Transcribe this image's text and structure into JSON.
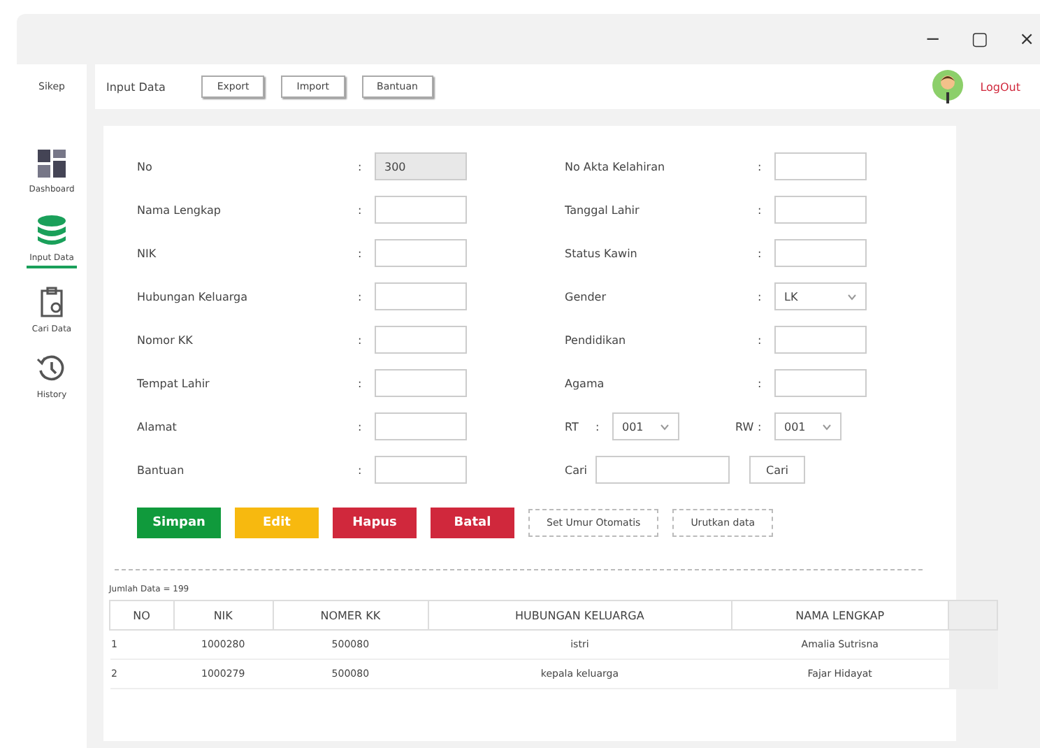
{
  "window": {
    "controls": [
      "−",
      "▢",
      "×"
    ]
  },
  "sidebar": {
    "logo": "Sikep",
    "items": [
      {
        "label": "Dashboard",
        "selected": false
      },
      {
        "label": "Input Data",
        "selected": true
      },
      {
        "label": "Cari Data",
        "selected": false
      },
      {
        "label": "History",
        "selected": false
      }
    ]
  },
  "header": {
    "title": "Input Data",
    "buttons": [
      "Export",
      "Import",
      "Bantuan"
    ],
    "logout": "LogOut"
  },
  "form": {
    "left": [
      {
        "label": "No",
        "colon": ":",
        "value": "300",
        "disabled": true
      },
      {
        "label": "Nama Lengkap",
        "colon": ":",
        "disabled": false
      },
      {
        "label": "NIK",
        "colon": ":",
        "disabled": false
      },
      {
        "label": "Hubungan Keluarga",
        "colon": ":",
        "disabled": false
      },
      {
        "label": "Nomor KK",
        "colon": ":",
        "disabled": false
      },
      {
        "label": "Tempat Lahir",
        "colon": ":",
        "disabled": false
      },
      {
        "label": "Alamat",
        "colon": ":",
        "disabled": false
      },
      {
        "label": "Bantuan",
        "colon": ":",
        "disabled": false
      }
    ],
    "right": [
      {
        "label": "No Akta Kelahiran",
        "colon": ":",
        "kind": "text"
      },
      {
        "label": "Tanggal Lahir",
        "colon": ":",
        "kind": "text"
      },
      {
        "label": "Status Kawin",
        "colon": ":",
        "kind": "text"
      },
      {
        "label": "Gender",
        "colon": ":",
        "kind": "select",
        "value": "LK"
      },
      {
        "label": "Pendidikan",
        "colon": ":",
        "kind": "text"
      },
      {
        "label": "Agama",
        "colon": ":",
        "kind": "text"
      }
    ],
    "rt": {
      "label": "RT",
      "colon": ":",
      "value": "001"
    },
    "rw": {
      "label": "RW",
      "colon": ":",
      "value": "001"
    },
    "search": {
      "label": "Cari",
      "button": "Cari"
    }
  },
  "actions": [
    {
      "label": "Simpan",
      "color": "#109a3c"
    },
    {
      "label": "Edit",
      "color": "#f7b90f"
    },
    {
      "label": "Hapus",
      "color": "#d0283c"
    },
    {
      "label": "Batal",
      "color": "#d0283c"
    }
  ],
  "extra_buttons": [
    "Set Umur Otomatis",
    "Urutkan data"
  ],
  "count": "Jumlah Data = 199",
  "table": {
    "columns": [
      "NO",
      "NIK",
      "NOMER KK",
      "HUBUNGAN KELUARGA",
      "NAMA LENGKAP"
    ],
    "rows": [
      [
        "1",
        "1000280",
        "500080",
        "istri",
        "Amalia Sutrisna"
      ],
      [
        "2",
        "1000279",
        "500080",
        "kepala keluarga",
        "Fajar Hidayat"
      ]
    ]
  }
}
